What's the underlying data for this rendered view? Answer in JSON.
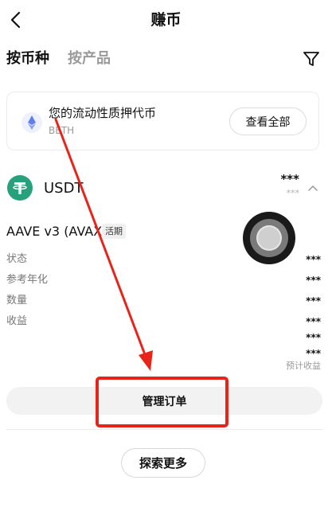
{
  "header": {
    "title": "赚币"
  },
  "tabs": [
    {
      "label": "按币种",
      "active": true
    },
    {
      "label": "按产品",
      "active": false
    }
  ],
  "featured": {
    "title": "您的流动性质押代币",
    "subtitle": "BETH",
    "view_all_label": "查看全部",
    "icon": "ethereum-icon"
  },
  "asset": {
    "symbol": "USDT",
    "amount": "***",
    "sub_amount": "***",
    "icon": "tether-icon"
  },
  "product": {
    "name": "AAVE v3 (AVAX)",
    "badge": "活期",
    "rows": [
      {
        "label": "状态",
        "value": "***"
      },
      {
        "label": "参考年化",
        "value": "***"
      },
      {
        "label": "数量",
        "value": "***"
      },
      {
        "label": "收益",
        "value": "***"
      }
    ],
    "extra_values": [
      "***",
      "***"
    ],
    "estimate_label": "预计收益"
  },
  "actions": {
    "manage_orders_label": "管理订单",
    "explore_more_label": "探索更多"
  },
  "colors": {
    "annotation_red": "#e8241a",
    "usdt_green": "#26a17b",
    "eth_blue": "#627eea"
  }
}
